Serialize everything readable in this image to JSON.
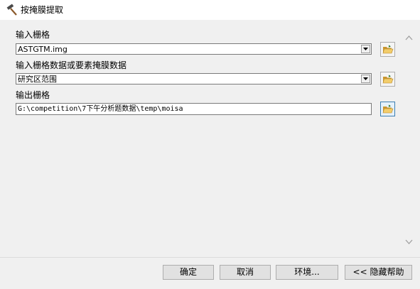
{
  "window": {
    "title": "按掩膜提取",
    "icon": "hammer-icon"
  },
  "fields": [
    {
      "label": "输入栅格",
      "value": "ASTGTM.img",
      "type": "combobox"
    },
    {
      "label": "输入栅格数据或要素掩膜数据",
      "value": "研究区范围",
      "type": "combobox"
    },
    {
      "label": "输出栅格",
      "value": "G:\\competition\\7下午分析题数据\\temp\\moisa",
      "type": "textbox"
    }
  ],
  "buttons": {
    "ok": "确定",
    "cancel": "取消",
    "environments": "环境...",
    "hide_help": "<< 隐藏帮助"
  },
  "colors": {
    "accent_border": "#3c7fb1",
    "folder_yellow": "#e8b84a"
  }
}
